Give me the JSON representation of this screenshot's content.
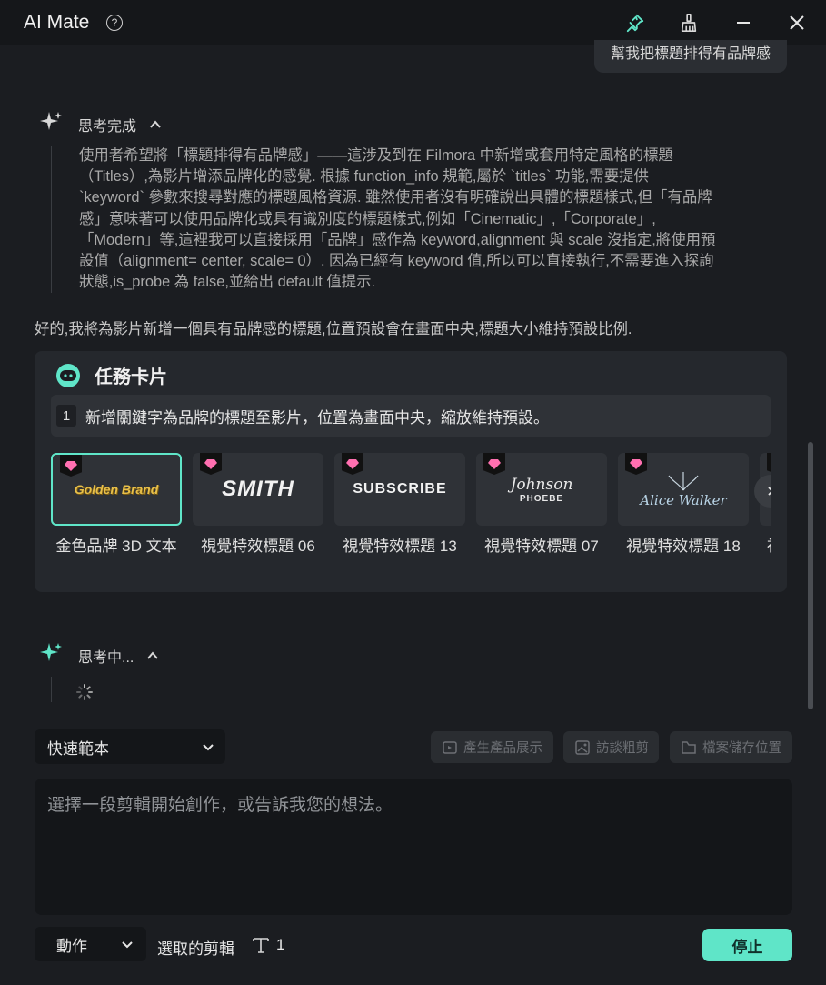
{
  "app": {
    "title": "AI Mate"
  },
  "user_message": "幫我把標題排得有品牌感",
  "thinking_done": {
    "label": "思考完成",
    "text": "使用者希望將「標題排得有品牌感」——這涉及到在 Filmora 中新增或套用特定風格的標題\n（Titles）,為影片增添品牌化的感覺. 根據 function_info 規範,屬於 `titles` 功能,需要提供\n`keyword` 參數來搜尋對應的標題風格資源. 雖然使用者沒有明確說出具體的標題樣式,但「有品牌\n感」意味著可以使用品牌化或具有識別度的標題樣式,例如「Cinematic」,「Corporate」,\n「Modern」等,這裡我可以直接採用「品牌」感作為 keyword,alignment 與 scale 沒指定,將使用預\n設值（alignment= center, scale= 0）. 因為已經有 keyword 值,所以可以直接執行,不需要進入探詢\n狀態,is_probe 為 false,並給出 default 值提示."
  },
  "reply": "好的,我將為影片新增一個具有品牌感的標題,位置預設會在畫面中央,標題大小維持預設比例.",
  "task_card": {
    "title": "任務卡片",
    "step_number": "1",
    "step_text": "新增關鍵字為品牌的標題至影片，位置為畫面中央，縮放維持預設。",
    "templates": [
      {
        "label": "金色品牌 3D 文本",
        "preview": "Golden Brand"
      },
      {
        "label": "視覺特效標題 06",
        "preview": "SMITH"
      },
      {
        "label": "視覺特效標題 13",
        "preview": "SUBSCRIBE"
      },
      {
        "label": "視覺特效標題 07",
        "preview": "Johnson",
        "preview_sub": "PHOEBE"
      },
      {
        "label": "視覺特效標題 18",
        "preview": "Alice Walker"
      },
      {
        "label": "視"
      }
    ]
  },
  "thinking_active": {
    "label": "思考中..."
  },
  "toolbar": {
    "quick_template": "快速範本",
    "buttons": [
      "產生產品展示",
      "訪談粗剪",
      "檔案儲存位置"
    ]
  },
  "input": {
    "placeholder": "選擇一段剪輯開始創作，或告訴我您的想法。"
  },
  "footer": {
    "action_label": "動作",
    "selected_clips_label": "選取的剪輯",
    "selected_count": "1",
    "stop_label": "停止"
  },
  "colors": {
    "accent": "#5fe5c8",
    "background": "#1b1d21",
    "titlebar": "#15171a"
  },
  "icons": [
    "help-icon",
    "pin-icon",
    "broom-icon",
    "minimize-icon",
    "close-icon",
    "sparkle-icon",
    "chevron-up-icon",
    "robot-icon",
    "gem-icon",
    "chevron-right-icon",
    "spinner-icon",
    "chevron-down-icon",
    "product-demo-icon",
    "image-icon",
    "folder-icon",
    "text-icon"
  ]
}
